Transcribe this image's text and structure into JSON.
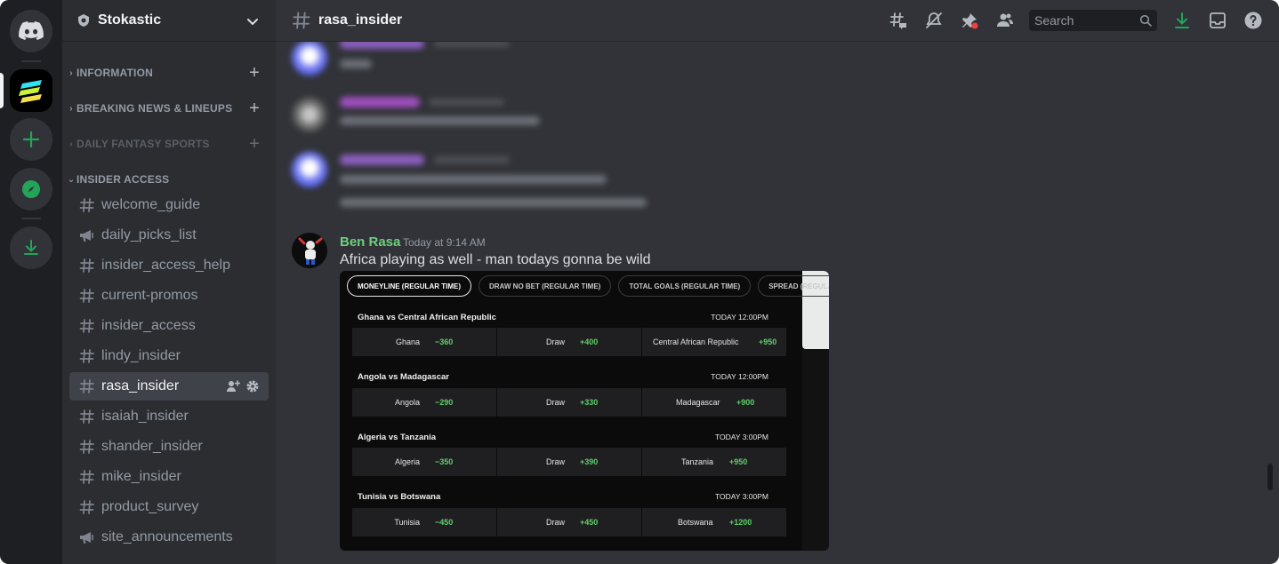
{
  "server": {
    "name": "Stokastic"
  },
  "sidebar": {
    "categories": [
      {
        "label": "INFORMATION"
      },
      {
        "label": "BREAKING NEWS & LINEUPS"
      },
      {
        "label": "DAILY FANTASY SPORTS"
      },
      {
        "label": "INSIDER ACCESS"
      }
    ],
    "channels": [
      {
        "label": "welcome_guide"
      },
      {
        "label": "daily_picks_list"
      },
      {
        "label": "insider_access_help"
      },
      {
        "label": "current-promos"
      },
      {
        "label": "insider_access"
      },
      {
        "label": "lindy_insider"
      },
      {
        "label": "rasa_insider"
      },
      {
        "label": "isaiah_insider"
      },
      {
        "label": "shander_insider"
      },
      {
        "label": "mike_insider"
      },
      {
        "label": "product_survey"
      },
      {
        "label": "site_announcements"
      }
    ]
  },
  "header": {
    "channel": "rasa_insider",
    "search_placeholder": "Search"
  },
  "message": {
    "author": "Ben Rasa",
    "time": "Today at 9:14 AM",
    "text": "Africa playing as well - man todays gonna be wild"
  },
  "embed": {
    "tabs": [
      "MONEYLINE (REGULAR TIME)",
      "DRAW NO BET (REGULAR TIME)",
      "TOTAL GOALS (REGULAR TIME)",
      "SPREAD (REGULAR TIME)"
    ],
    "games": [
      {
        "title": "Ghana vs Central African Republic",
        "time": "TODAY 12:00PM",
        "home": "Ghana",
        "home_odds": "−360",
        "draw": "Draw",
        "draw_odds": "+400",
        "away": "Central African Republic",
        "away_odds": "+950"
      },
      {
        "title": "Angola vs Madagascar",
        "time": "TODAY 12:00PM",
        "home": "Angola",
        "home_odds": "−290",
        "draw": "Draw",
        "draw_odds": "+330",
        "away": "Madagascar",
        "away_odds": "+900"
      },
      {
        "title": "Algeria vs Tanzania",
        "time": "TODAY 3:00PM",
        "home": "Algeria",
        "home_odds": "−350",
        "draw": "Draw",
        "draw_odds": "+390",
        "away": "Tanzania",
        "away_odds": "+950"
      },
      {
        "title": "Tunisia vs Botswana",
        "time": "TODAY 3:00PM",
        "home": "Tunisia",
        "home_odds": "−450",
        "draw": "Draw",
        "draw_odds": "+450",
        "away": "Botswana",
        "away_odds": "+1200"
      }
    ]
  },
  "colors": {
    "accent_green": "#23a559",
    "author_green": "#6fcf7e",
    "odds_green": "#5fcf6b"
  }
}
